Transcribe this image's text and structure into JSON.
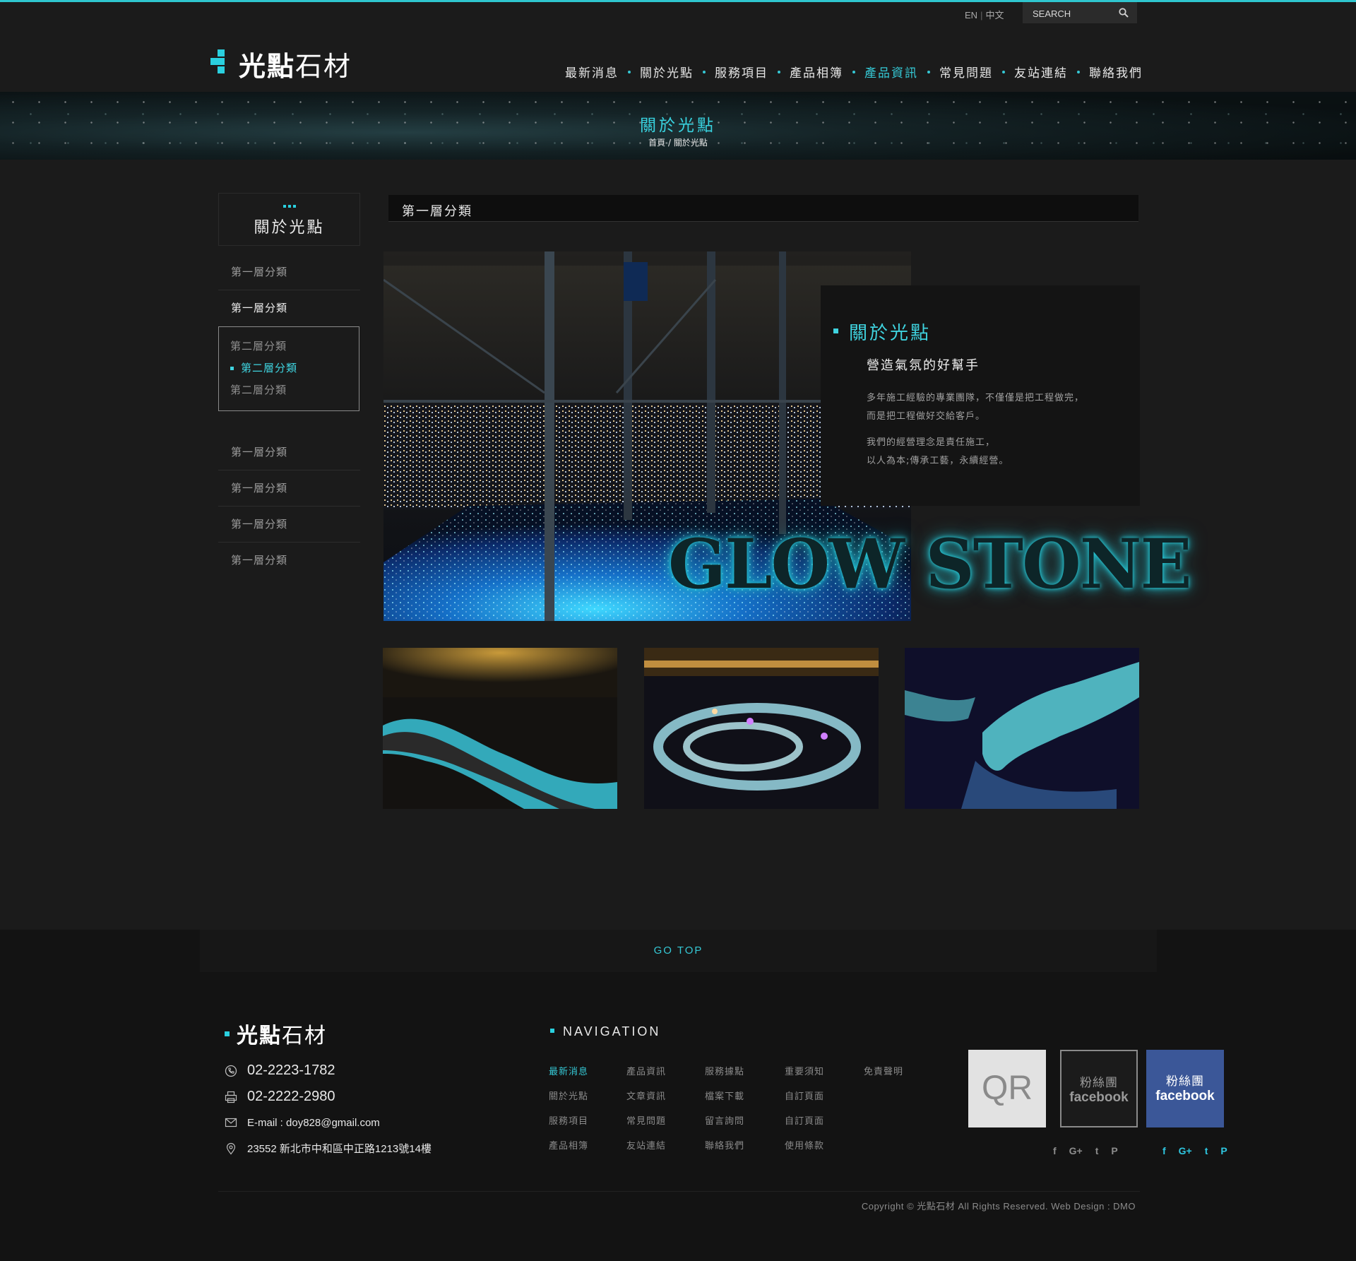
{
  "header": {
    "lang_en": "EN",
    "lang_sep": "|",
    "lang_zh": "中文",
    "search_placeholder": "SEARCH",
    "search_icon": "search-icon",
    "logo_bold": "光點",
    "logo_light": "石材",
    "accent_color": "#2ad0df"
  },
  "nav": {
    "items": [
      {
        "label": "最新消息"
      },
      {
        "label": "關於光點"
      },
      {
        "label": "服務項目"
      },
      {
        "label": "產品相簿"
      },
      {
        "label": "產品資訊",
        "active": true
      },
      {
        "label": "常見問題"
      },
      {
        "label": "友站連結"
      },
      {
        "label": "聯絡我們"
      }
    ]
  },
  "banner": {
    "title": "關於光點",
    "breadcrumb": "首頁 /  關於光點"
  },
  "sidebar": {
    "title": "關於光點",
    "items": [
      {
        "label": "第一層分類"
      },
      {
        "label": "第一層分類"
      },
      {
        "label": "第一層分類"
      },
      {
        "label": "第一層分類"
      },
      {
        "label": "第一層分類"
      },
      {
        "label": "第一層分類"
      }
    ],
    "sub_items": [
      {
        "label": "第二層分類"
      },
      {
        "label": "第二層分類",
        "active": true
      },
      {
        "label": "第二層分類"
      }
    ]
  },
  "main": {
    "section_title": "第一層分類",
    "hero_text": "GLOW STONE",
    "info": {
      "title": "關於光點",
      "subtitle": "營造氣氛的好幫手",
      "para1_line1": "多年施工經驗的專業團隊，不僅僅是把工程做完，",
      "para1_line2": "而是把工程做好交給客戶。",
      "para2_line1": "我們的經營理念是責任施工，",
      "para2_line2": "以人為本;傳承工藝，永續經營。"
    }
  },
  "footer": {
    "go_top": "GO TOP",
    "logo_bold": "光點",
    "logo_light": "石材",
    "phone": "02-2223-1782",
    "fax": "02-2222-2980",
    "email": "E-mail : doy828@gmail.com",
    "address": "23552 新北市中和區中正路1213號14樓",
    "nav_title": "NAVIGATION",
    "nav_columns": [
      [
        "最新消息",
        "關於光點",
        "服務項目",
        "產品相簿"
      ],
      [
        "產品資訊",
        "文章資訊",
        "常見問題",
        "友站連結"
      ],
      [
        "服務據點",
        "檔案下載",
        "留言詢問",
        "聯絡我們"
      ],
      [
        "重要須知",
        "自訂頁面",
        "自訂頁面",
        "使用條款"
      ],
      [
        "免責聲明"
      ]
    ],
    "qr_label": "QR",
    "fb_fan_label": "粉絲團",
    "fb_label": "facebook",
    "fb_color": "#3b5798",
    "social_grey": [
      "f",
      "G+",
      "t",
      "P"
    ],
    "social_blue": [
      "f",
      "G+",
      "t",
      "P"
    ],
    "copyright": "Copyright © 光點石材  All Rights Reserved. Web Design : DMO"
  }
}
